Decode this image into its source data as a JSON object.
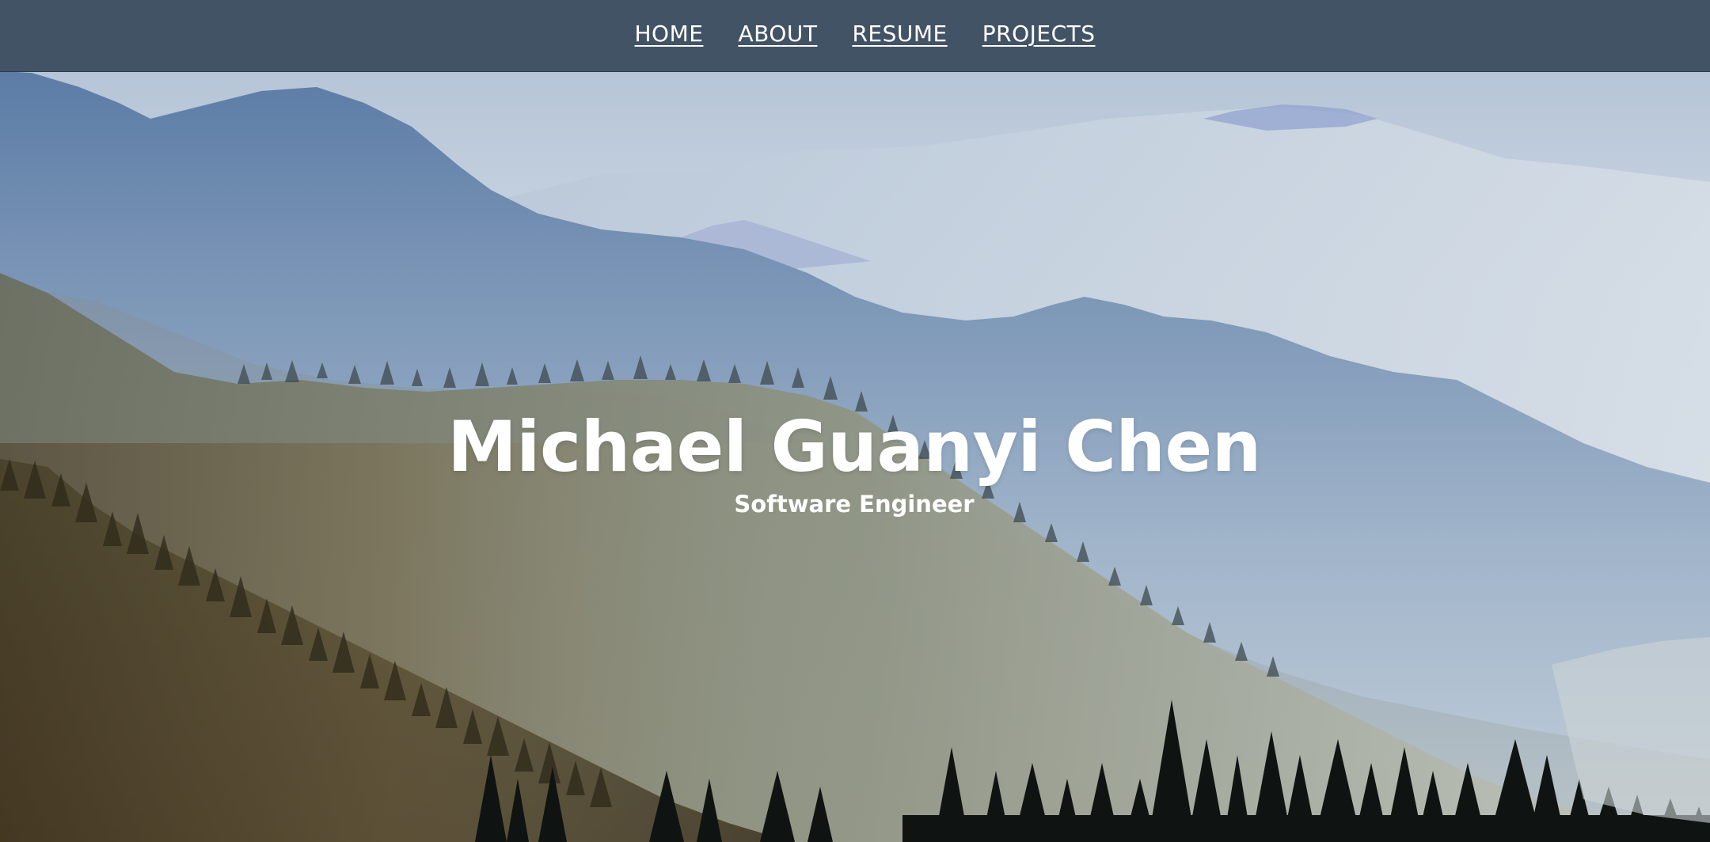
{
  "nav": {
    "items": [
      {
        "label": "HOME"
      },
      {
        "label": "ABOUT"
      },
      {
        "label": "RESUME"
      },
      {
        "label": "PROJECTS"
      }
    ]
  },
  "hero": {
    "name": "Michael Guanyi Chen",
    "title": "Software Engineer",
    "background": "misty-mountain-forest-photo"
  },
  "colors": {
    "navbar": "#435366",
    "text": "#ffffff",
    "sky": "#c9d4df"
  }
}
